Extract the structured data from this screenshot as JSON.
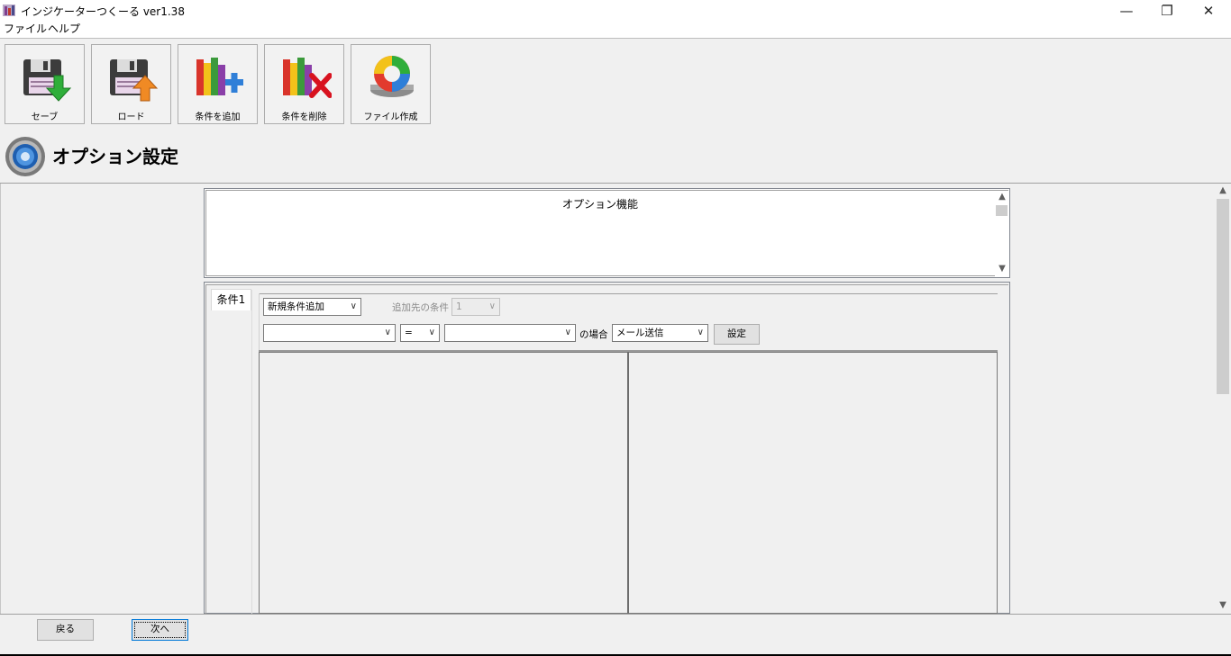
{
  "window": {
    "title": "インジケーターつくーる ver1.38",
    "controls": {
      "minimize": "—",
      "maximize": "❐",
      "close": "✕"
    }
  },
  "menu": {
    "items": [
      "ファイル",
      "ヘルプ"
    ]
  },
  "toolbar": {
    "save": "セーブ",
    "load": "ロード",
    "add_condition": "条件を追加",
    "delete_condition": "条件を削除",
    "create_file": "ファイル作成"
  },
  "page": {
    "title": "オプション設定"
  },
  "description": {
    "title": "オプション機能"
  },
  "tabs": [
    {
      "label": "条件1",
      "selected": true
    }
  ],
  "condition_form": {
    "new_condition": "新規条件追加",
    "target_label": "追加先の条件",
    "target_value": "1",
    "left_operand": "",
    "operator": "=",
    "right_operand": "",
    "case_label": "の場合",
    "action": "メール送信",
    "set_button": "設定"
  },
  "navigation": {
    "back": "戻る",
    "next": "次へ"
  },
  "colors": {
    "accent_focus": "#0078d7",
    "window_bg": "#f0f0f0"
  }
}
